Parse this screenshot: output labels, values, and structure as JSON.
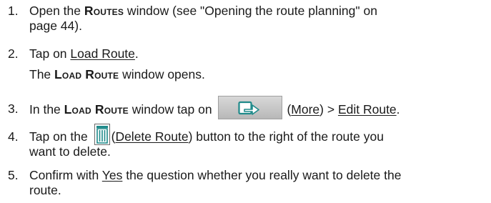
{
  "steps": [
    {
      "number": "1.",
      "line1_pre": "Open the ",
      "line1_sc": "Routes",
      "line1_post": " window (see \"Opening the route planning\" on",
      "line2": "page 44)."
    },
    {
      "number": "2.",
      "pre": "Tap on ",
      "link": "Load Route",
      "post": ".",
      "sub_sc": "Load Route",
      "sub_post": " window opens.",
      "sub_pre": "The "
    },
    {
      "number": "3.",
      "pre": "In the ",
      "sc": "Load Route",
      "mid": " window tap on ",
      "icon": "more-arrow-icon",
      "paren_open": "(",
      "link1": "More",
      "paren_close": ") > ",
      "link2": "Edit Route",
      "end": "."
    },
    {
      "number": "4.",
      "pre": "Tap on the ",
      "icon": "trash-icon",
      "paren_open": "(",
      "link": "Delete Route",
      "post": ") button to the right of the route you",
      "line2": "want to delete."
    },
    {
      "number": "5.",
      "pre": "Confirm with ",
      "link": "Yes",
      "post": " the question whether you really want to delete the",
      "line2": "route."
    }
  ],
  "colors": {
    "text": "#1a1a1a",
    "icon_accent": "#1f8a8a",
    "button_bg": "#c8c8c8"
  }
}
